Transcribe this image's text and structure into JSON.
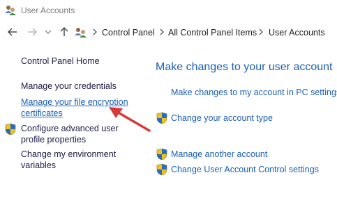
{
  "window": {
    "title": "User Accounts"
  },
  "breadcrumb": [
    "Control Panel",
    "All Control Panel Items",
    "User Accounts"
  ],
  "sidebar": {
    "items": [
      {
        "label": "Control Panel Home"
      },
      {
        "label": "Manage your credentials"
      },
      {
        "label_line1": "Manage your file encryption",
        "label_line2": "certificates"
      },
      {
        "label_line1": "Configure advanced user",
        "label_line2": "profile properties"
      },
      {
        "label_line1": "Change my environment",
        "label_line2": "variables"
      }
    ]
  },
  "main": {
    "heading": "Make changes to your user account",
    "tasks": [
      {
        "label": "Make changes to my account in PC settings"
      },
      {
        "label": "Change your account type"
      },
      {
        "label": "Manage another account"
      },
      {
        "label": "Change User Account Control settings"
      }
    ]
  },
  "colors": {
    "link": "#1a5fb4",
    "arrow": "#d63a3a"
  }
}
